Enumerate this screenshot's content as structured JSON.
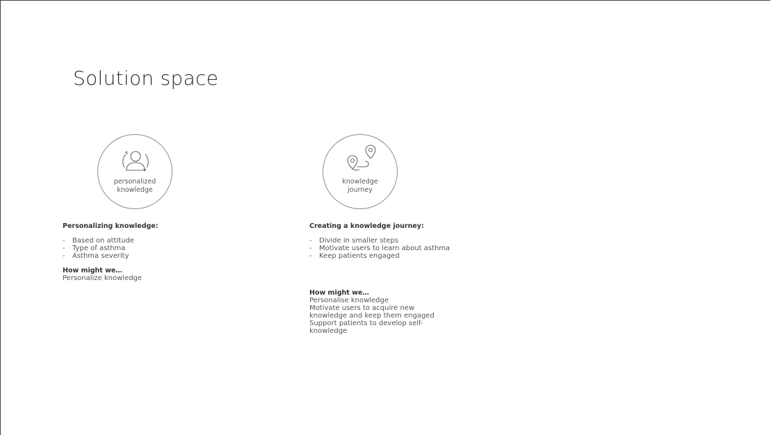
{
  "slide": {
    "title": "Solution space"
  },
  "left": {
    "circle_label_line1": "personalized",
    "circle_label_line2": "knowledge",
    "heading": "Personalizing knowledge:",
    "bullets": [
      "Based on attitude",
      "Type of asthma",
      "Asthma severity"
    ],
    "hmw_title": "How might we…",
    "hmw_items": [
      "Personalize knowledge"
    ],
    "icon": "person-cycle-icon"
  },
  "right": {
    "circle_label_line1": "knowledge",
    "circle_label_line2": "journey",
    "heading": "Creating a knowledge journey:",
    "bullets": [
      "Divide in smaller steps",
      "Motivate users to learn about asthma",
      "Keep patients engaged"
    ],
    "hmw_title": "How might we…",
    "hmw_items": [
      "Personalise knowledge",
      "Motivate users to acquire new",
      "knowledge and keep them engaged",
      "Support patients to develop self-",
      "knowledge"
    ],
    "icon": "route-pins-icon"
  }
}
